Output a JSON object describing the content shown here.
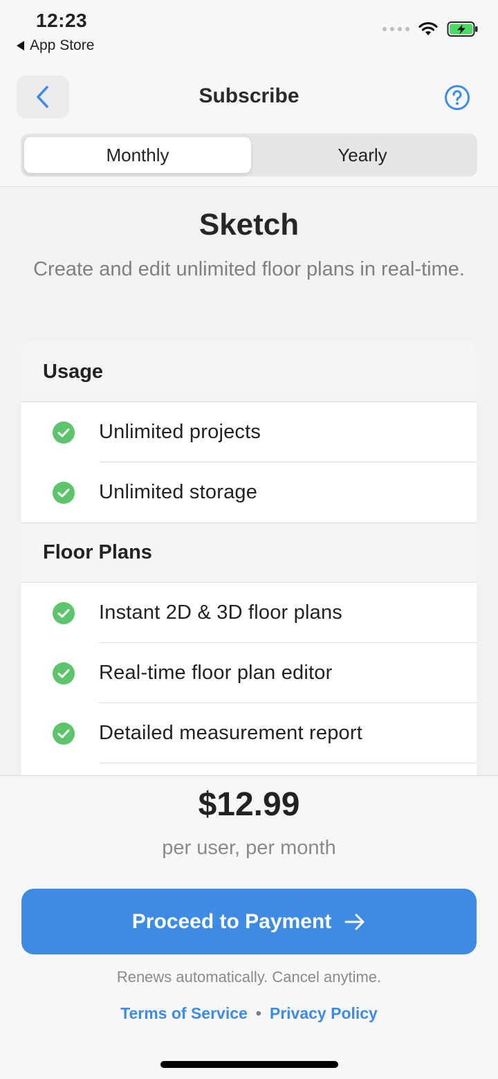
{
  "status_bar": {
    "time": "12:23",
    "back_app_label": "App Store",
    "icons": [
      "signal-dots-icon",
      "wifi-icon",
      "battery-charging-icon"
    ]
  },
  "nav": {
    "title": "Subscribe",
    "back_icon": "chevron-left-icon",
    "help_icon": "question-circle-icon"
  },
  "billing_toggle": {
    "options": [
      "Monthly",
      "Yearly"
    ],
    "selected": "Monthly"
  },
  "plan": {
    "name": "Sketch",
    "description": "Create and edit unlimited floor plans in real-time."
  },
  "features": {
    "sections": [
      {
        "title": "Usage",
        "items": [
          "Unlimited projects",
          "Unlimited storage"
        ]
      },
      {
        "title": "Floor Plans",
        "items": [
          "Instant 2D & 3D floor plans",
          "Real-time floor plan editor",
          "Detailed measurement report"
        ]
      }
    ]
  },
  "pricing": {
    "price": "$12.99",
    "period": "per user, per month"
  },
  "cta": {
    "label": "Proceed to Payment",
    "icon": "arrow-right-icon"
  },
  "renewal_note": "Renews automatically. Cancel anytime.",
  "legal": {
    "terms": "Terms of Service",
    "separator": "•",
    "privacy": "Privacy Policy"
  },
  "colors": {
    "accent": "#3d8be4",
    "check": "#5cc46b"
  }
}
